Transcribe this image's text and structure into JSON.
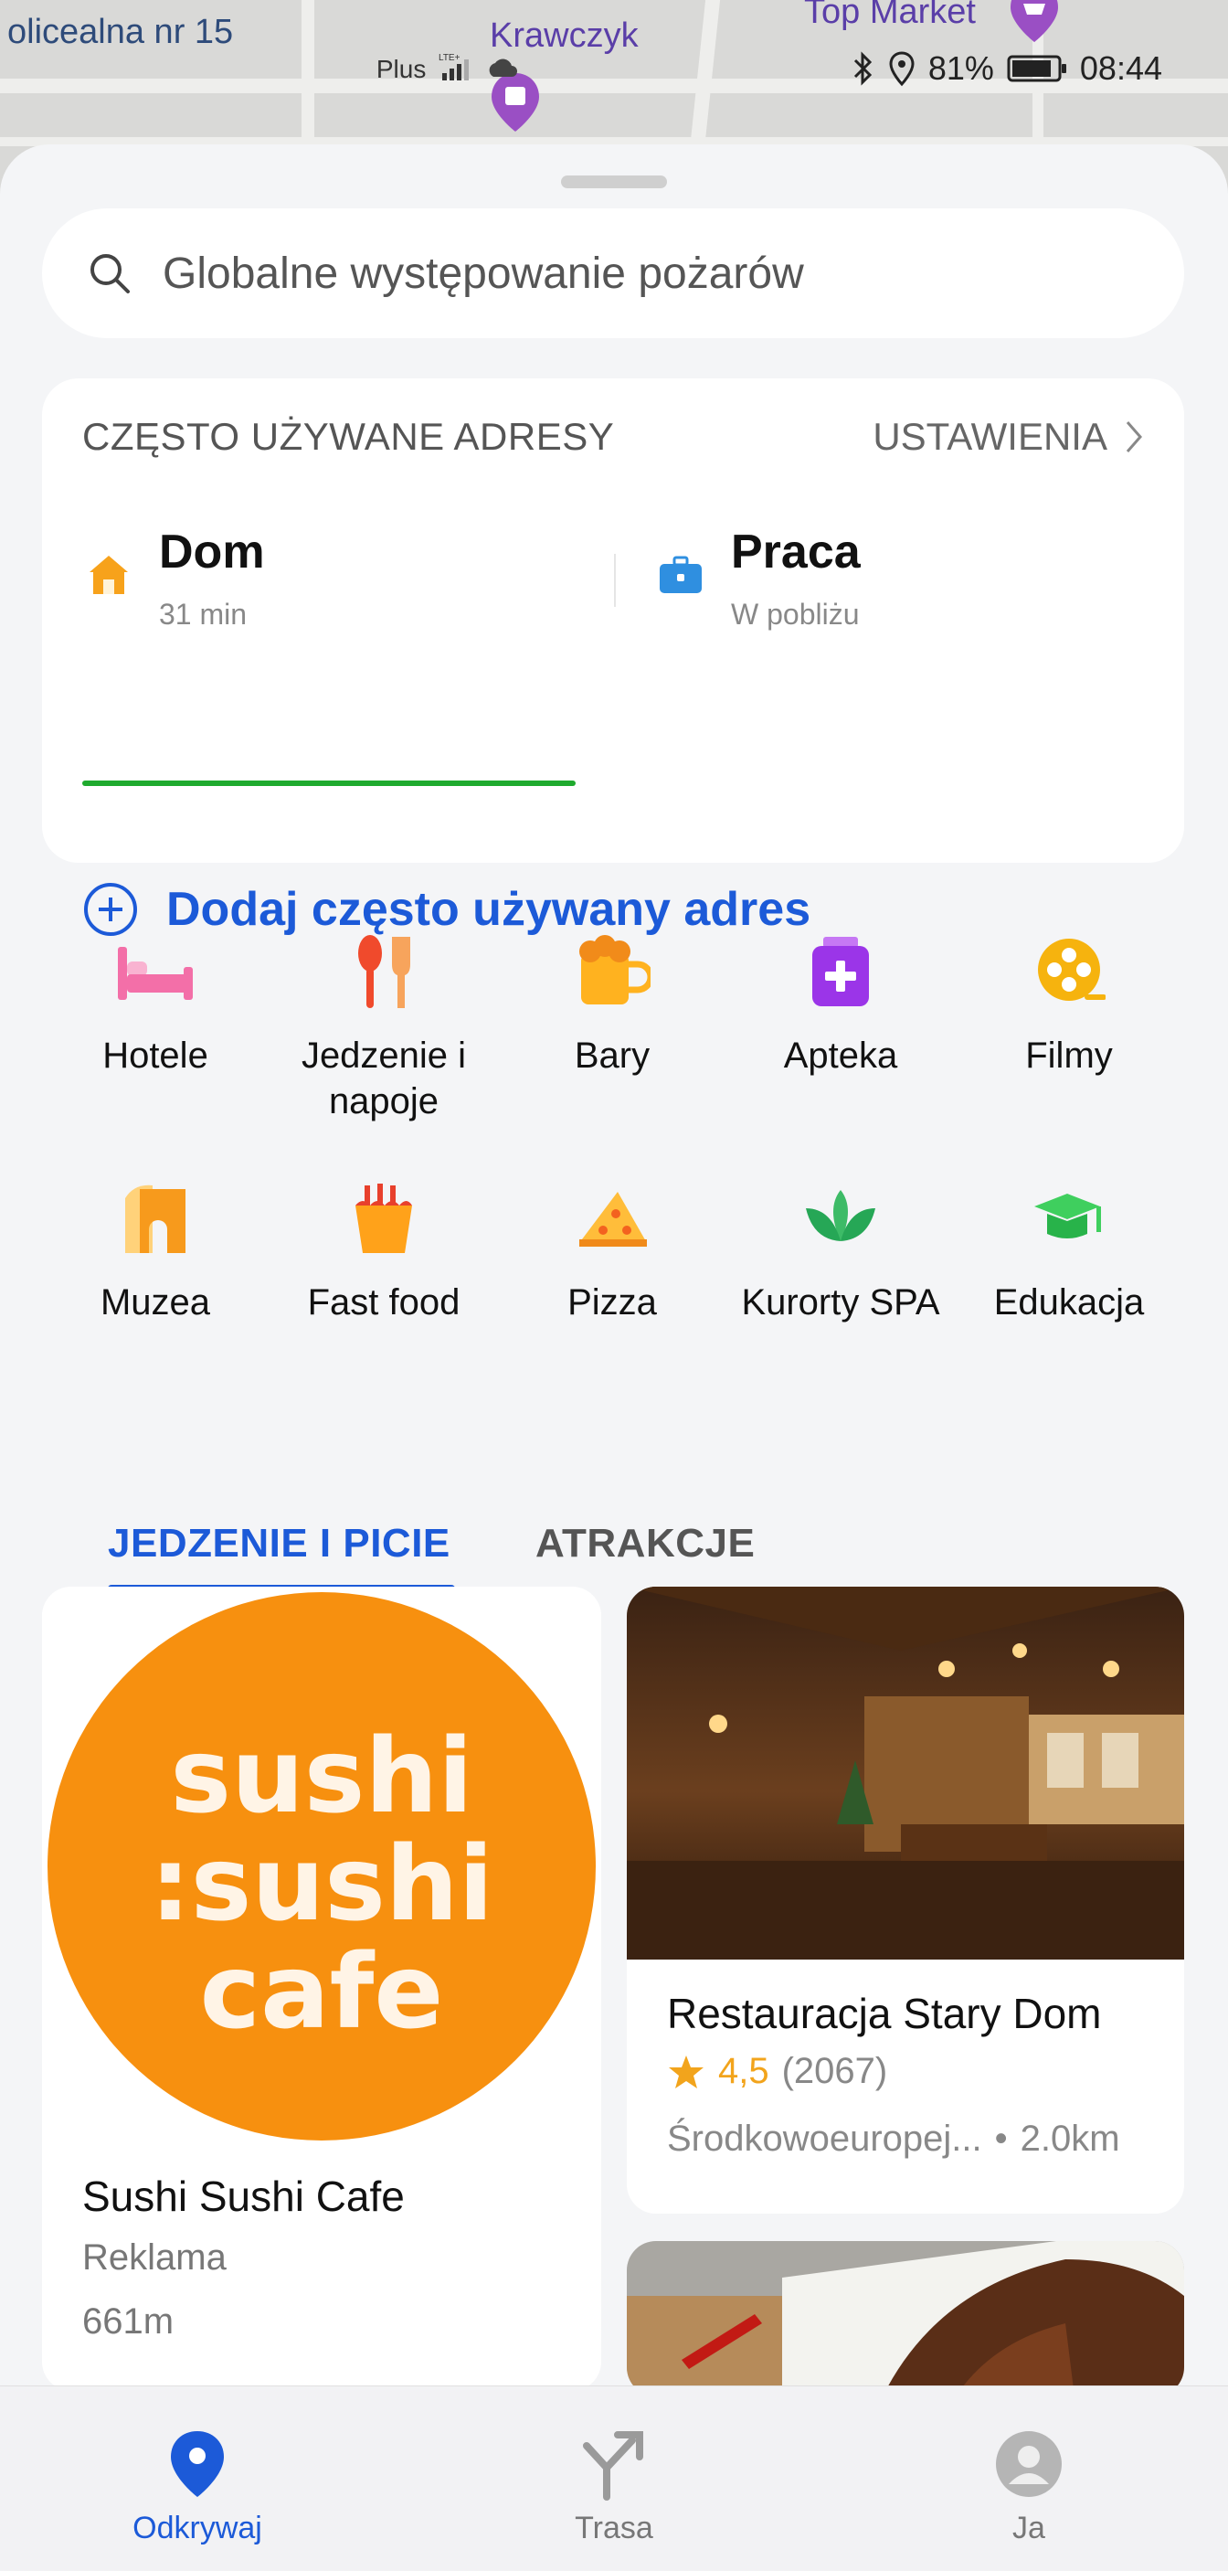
{
  "map": {
    "labels": [
      "olicealna nr 15",
      "Krawczyk",
      "Top Market"
    ]
  },
  "status_bar": {
    "network": "Plus",
    "battery": "81%",
    "time": "08:44"
  },
  "search": {
    "placeholder": "Globalne występowanie pożarów"
  },
  "frequent": {
    "header": "CZĘSTO UŻYWANE ADRESY",
    "settings": "USTAWIENIA",
    "home": {
      "name": "Dom",
      "sub": "31 min"
    },
    "work": {
      "name": "Praca",
      "sub": "W pobliżu"
    },
    "add_label": "Dodaj często używany adres"
  },
  "categories": [
    {
      "label": "Hotele",
      "icon": "bed-icon"
    },
    {
      "label": "Jedzenie i napoje",
      "icon": "cutlery-icon"
    },
    {
      "label": "Bary",
      "icon": "beer-icon"
    },
    {
      "label": "Apteka",
      "icon": "pharmacy-icon"
    },
    {
      "label": "Filmy",
      "icon": "film-reel-icon"
    },
    {
      "label": "Muzea",
      "icon": "museum-icon"
    },
    {
      "label": "Fast food",
      "icon": "fastfood-icon"
    },
    {
      "label": "Pizza",
      "icon": "pizza-icon"
    },
    {
      "label": "Kurorty SPA",
      "icon": "lotus-icon"
    },
    {
      "label": "Edukacja",
      "icon": "graduation-cap-icon"
    }
  ],
  "tabs": [
    "JEDZENIE I PICIE",
    "ATRAKCJE"
  ],
  "places": {
    "sushi": {
      "logo_text": [
        "sushi",
        ":sushi",
        "cafe"
      ],
      "name": "Sushi Sushi Cafe",
      "label": "Reklama",
      "distance": "661m"
    },
    "restaurant": {
      "name": "Restauracja Stary Dom",
      "rating": "4,5",
      "reviews": "(2067)",
      "cuisine": "Środkowoeuropej...",
      "distance": "2.0km"
    }
  },
  "nav": {
    "discover": "Odkrywaj",
    "route": "Trasa",
    "me": "Ja"
  },
  "colors": {
    "accent": "#1c5ad8",
    "progress": "#1faa2e",
    "star": "#f2a41c",
    "sushi_orange": "#f7900f"
  }
}
